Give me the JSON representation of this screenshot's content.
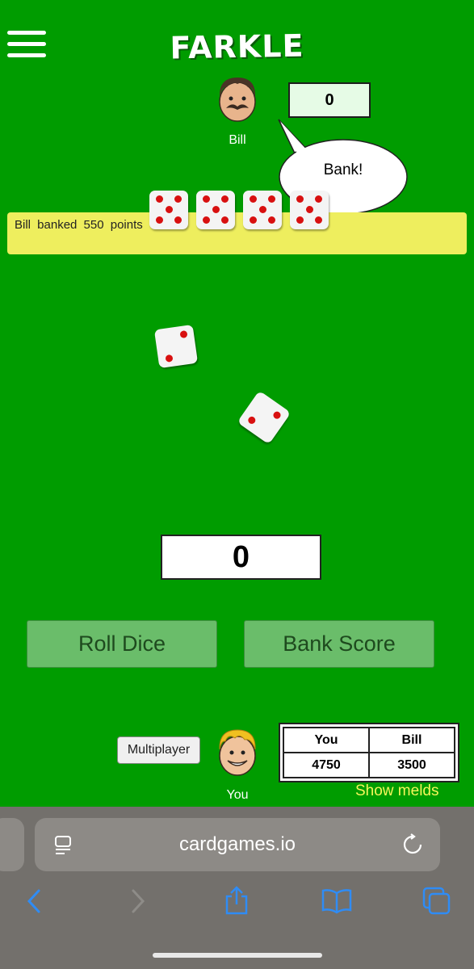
{
  "app": {
    "title": "FARKLE"
  },
  "opponent": {
    "name": "Bill",
    "score": "0",
    "speech": "Bank!"
  },
  "message": "Bill  banked  550  points",
  "turn_score": "0",
  "buttons": {
    "roll": "Roll Dice",
    "bank": "Bank Score",
    "multiplayer": "Multiplayer"
  },
  "player": {
    "name": "You"
  },
  "scoreboard": {
    "headers": [
      "You",
      "Bill"
    ],
    "scores": [
      "4750",
      "3500"
    ]
  },
  "show_melds": "Show melds",
  "held_dice": [
    5,
    5,
    5,
    5
  ],
  "rolled_dice": [
    2,
    2
  ],
  "browser": {
    "url": "cardgames.io",
    "icons": [
      "reader-icon",
      "reload-icon",
      "back-icon",
      "forward-icon",
      "share-icon",
      "bookmarks-icon",
      "tabs-icon"
    ]
  },
  "colors": {
    "table": "#009c00",
    "message_bar": "#eeee5e",
    "pip": "#d81010",
    "show_melds": "#f6f65a"
  }
}
